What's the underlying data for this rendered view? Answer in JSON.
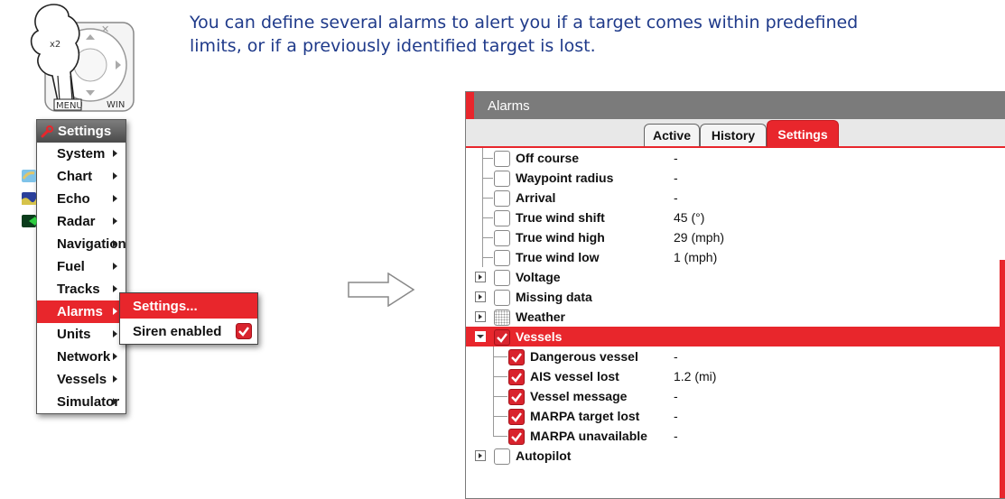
{
  "intro": {
    "line1": "You can define several alarms to alert you if a target comes within predefined",
    "line2": "limits, or if a previously identified target is lost."
  },
  "keypad": {
    "press_count": "x2",
    "menu_key": "MENU",
    "win_key": "WIN"
  },
  "settings_menu": {
    "title": "Settings",
    "items": [
      {
        "label": "System",
        "icon": ""
      },
      {
        "label": "Chart",
        "icon": "chart-icon"
      },
      {
        "label": "Echo",
        "icon": "echo-icon"
      },
      {
        "label": "Radar",
        "icon": "radar-icon"
      },
      {
        "label": "Navigation",
        "icon": ""
      },
      {
        "label": "Fuel",
        "icon": ""
      },
      {
        "label": "Tracks",
        "icon": ""
      },
      {
        "label": "Alarms",
        "icon": "",
        "active": true
      },
      {
        "label": "Units",
        "icon": ""
      },
      {
        "label": "Network",
        "icon": ""
      },
      {
        "label": "Vessels",
        "icon": ""
      },
      {
        "label": "Simulator",
        "icon": ""
      }
    ]
  },
  "alarms_submenu": {
    "settings_label": "Settings...",
    "siren_label": "Siren enabled",
    "siren_checked": true
  },
  "alarms_window": {
    "title": "Alarms",
    "tabs": [
      "Active",
      "History",
      "Settings"
    ],
    "selected_tab": "Settings",
    "rows": [
      {
        "label": "Off course",
        "value": "-",
        "checked": false
      },
      {
        "label": "Waypoint radius",
        "value": "-",
        "checked": false
      },
      {
        "label": "Arrival",
        "value": "-",
        "checked": false
      },
      {
        "label": "True wind shift",
        "value": "45 (°)",
        "checked": false
      },
      {
        "label": "True wind high",
        "value": "29 (mph)",
        "checked": false
      },
      {
        "label": "True wind low",
        "value": "1 (mph)",
        "checked": false
      },
      {
        "label": "Voltage",
        "value": "",
        "checked": false,
        "expandable": true
      },
      {
        "label": "Missing data",
        "value": "",
        "checked": false,
        "expandable": true
      },
      {
        "label": "Weather",
        "value": "",
        "checked": false,
        "expandable": true,
        "partial": true
      },
      {
        "label": "Vessels",
        "value": "",
        "checked": true,
        "expandable": true,
        "expanded": true,
        "selected": true
      },
      {
        "label": "Dangerous vessel",
        "value": "-",
        "checked": true,
        "child": true
      },
      {
        "label": "AIS vessel lost",
        "value": "1.2 (mi)",
        "checked": true,
        "child": true
      },
      {
        "label": "Vessel message",
        "value": "-",
        "checked": true,
        "child": true
      },
      {
        "label": "MARPA target lost",
        "value": "-",
        "checked": true,
        "child": true
      },
      {
        "label": "MARPA unavailable",
        "value": "-",
        "checked": true,
        "child": true
      },
      {
        "label": "Autopilot",
        "value": "",
        "checked": false,
        "expandable": true
      }
    ]
  },
  "colors": {
    "accent": "#e8262c",
    "title_bar": "#7b7b7b",
    "intro_text": "#1f3a8a"
  }
}
